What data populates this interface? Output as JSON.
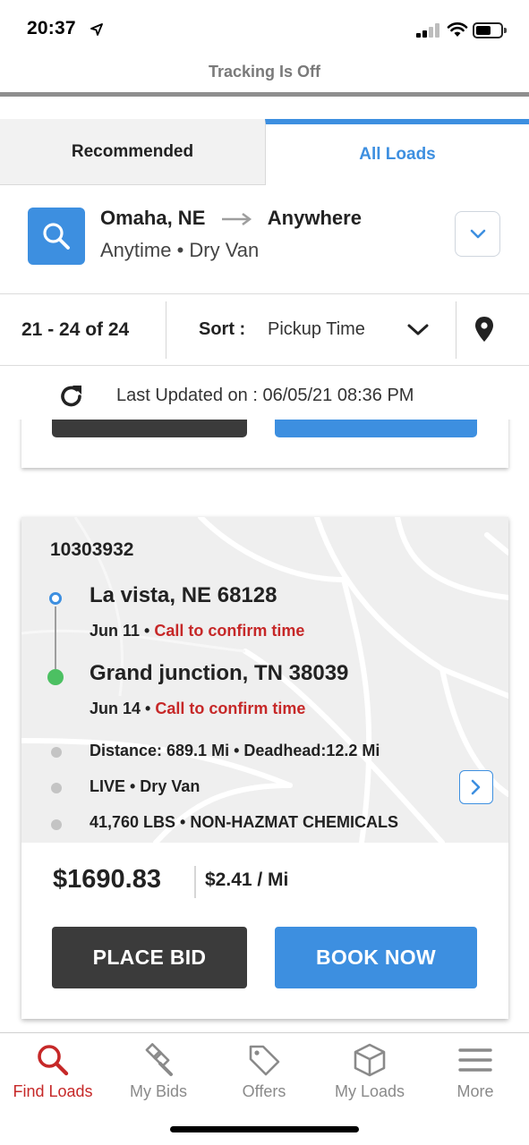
{
  "status_bar": {
    "time": "20:37"
  },
  "tracking": {
    "label": "Tracking Is Off"
  },
  "tabs": [
    {
      "label": "Recommended",
      "active": false
    },
    {
      "label": "All Loads",
      "active": true
    }
  ],
  "search": {
    "origin": "Omaha, NE",
    "destination": "Anywhere",
    "criteria": "Anytime • Dry Van"
  },
  "sort_bar": {
    "count": "21 - 24 of 24",
    "sort_label": "Sort :",
    "sort_value": "Pickup Time"
  },
  "last_updated": {
    "text": "Last Updated on : 06/05/21 08:36 PM"
  },
  "load": {
    "id": "10303932",
    "origin": {
      "city": "La vista, NE 68128",
      "date": "Jun 11 •",
      "note": "Call to confirm time"
    },
    "destination": {
      "city": "Grand junction, TN 38039",
      "date": "Jun 14 •",
      "note": "Call to confirm time"
    },
    "details": [
      "Distance: 689.1 Mi • Deadhead:12.2 Mi",
      "LIVE • Dry Van",
      "41,760 LBS • NON-HAZMAT CHEMICALS"
    ],
    "price": "$1690.83",
    "rate": "$2.41 / Mi",
    "place_bid_label": "PLACE BID",
    "book_now_label": "BOOK NOW"
  },
  "bottom_nav": [
    {
      "label": "Find Loads",
      "icon": "search-icon",
      "active": true
    },
    {
      "label": "My Bids",
      "icon": "gavel-icon",
      "active": false
    },
    {
      "label": "Offers",
      "icon": "tag-icon",
      "active": false
    },
    {
      "label": "My Loads",
      "icon": "box-icon",
      "active": false
    },
    {
      "label": "More",
      "icon": "menu-icon",
      "active": false
    }
  ],
  "colors": {
    "accent": "#3d8fe0",
    "warning": "#c62828",
    "dark_button": "#3b3b3b",
    "destination_dot": "#4cc062"
  }
}
